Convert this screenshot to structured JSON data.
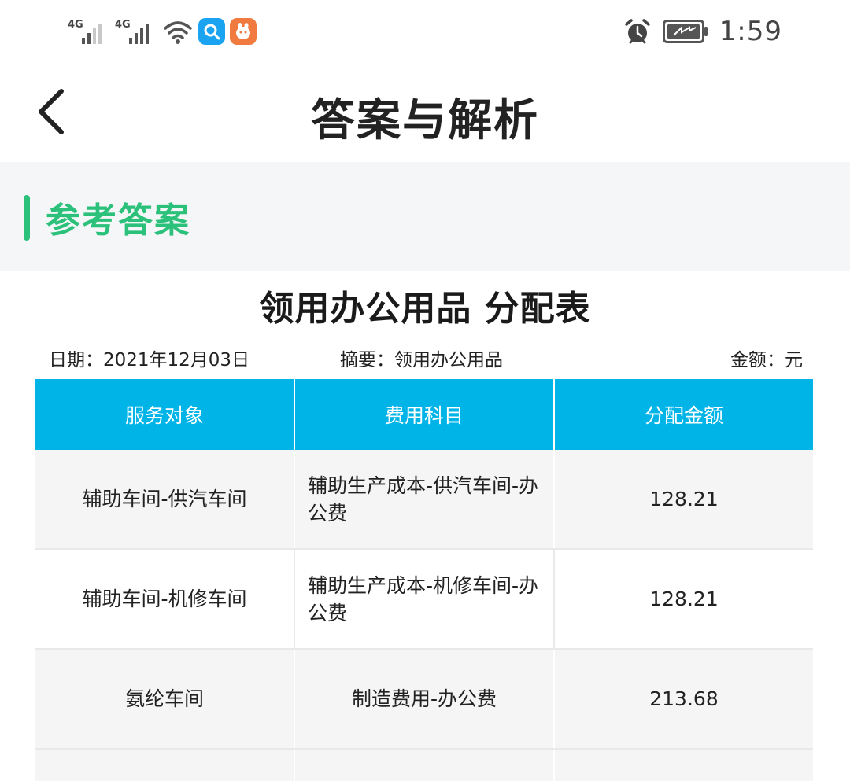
{
  "status_bar": {
    "signal_1_label": "4G",
    "signal_2_label": "4G",
    "time": "1:59"
  },
  "header": {
    "title": "答案与解析"
  },
  "section": {
    "title": "参考答案"
  },
  "table": {
    "title": "领用办公用品 分配表",
    "date": "日期：2021年12月03日",
    "summary": "摘要：领用办公用品",
    "unit": "金额：元",
    "columns": [
      "服务对象",
      "费用科目",
      "分配金额"
    ],
    "rows": [
      {
        "target": "辅助车间-供汽车间",
        "account": "辅助生产成本-供汽车间-办公费",
        "amount": "128.21"
      },
      {
        "target": "辅助车间-机修车间",
        "account": "辅助生产成本-机修车间-办公费",
        "amount": "128.21"
      },
      {
        "target": "氨纶车间",
        "account": "制造费用-办公费",
        "amount": "213.68"
      }
    ]
  },
  "colors": {
    "accent_green": "#2cc17b",
    "header_blue": "#00b4e8",
    "band_gray": "#f5f6f8"
  },
  "icons": {
    "back": "chevron-left-icon",
    "search_app": "search-app-icon",
    "orange_app": "mascot-app-icon",
    "alarm": "alarm-icon",
    "battery": "battery-charging-icon",
    "wifi": "wifi-icon"
  }
}
